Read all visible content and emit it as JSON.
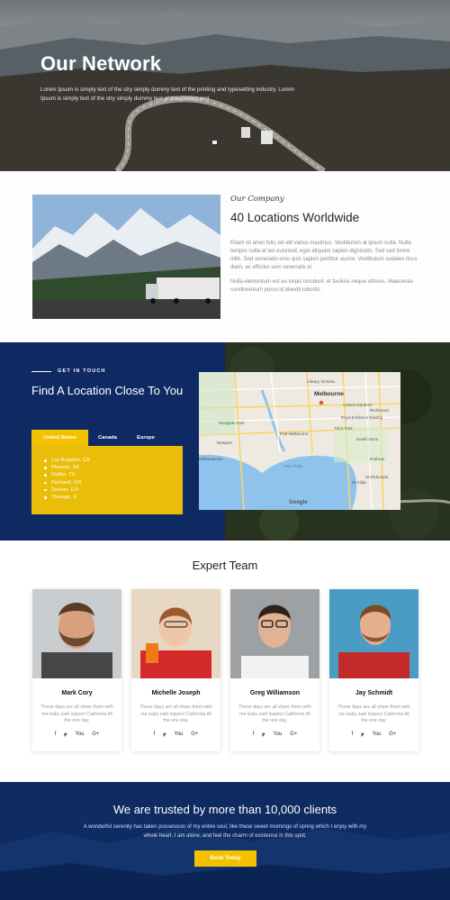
{
  "hero": {
    "title": "Our Network",
    "text": "Lorem Ipsum is simply text of the stry simply dummy text of the printing and typesetting industry. Lorem Ipsum is simply text of the stry simply dummy text of the printing and."
  },
  "company": {
    "subtitle": "Our Company",
    "title": "40 Locations Worldwide",
    "para1": "Etiam sit amet felis vel elit varius maximus. Vestibulum at ipsum nulla. Nulla tempor nulla et leo euismod, eget aliquam sapien dignissim. Sed sed lorem nibh. Sed venenatis eros quis sapien porttitor auctor. Vestibulum sodales risus diam, ac efficitur sem venenatis in.",
    "para2": "Nulla elementum est eu turpis tincidunt, et facilisis neque ultrices. Maecenas condimentum purus id blandit lobortis."
  },
  "location": {
    "eyebrow": "GET IN TOUCH",
    "title": "Find A Location Close To You",
    "tabs": [
      "United States",
      "Canada",
      "Europe"
    ],
    "active_tab": "United States",
    "cities": [
      "Los Angeles, CA",
      "Phoenix, AZ",
      "Dallas, TX",
      "Portland, OR",
      "Denver, CO",
      "Chicago, IL"
    ],
    "map": {
      "labels": [
        "Library Victoria",
        "Melbourne",
        "Carlton Gardens",
        "Royal Exhibition Building",
        "Richmond",
        "Yarra Park",
        "South Yarra",
        "Prahran",
        "St Kilda East",
        "St Kilda",
        "Port Melbourne",
        "Williamstown",
        "Newport",
        "Westgate Park",
        "Port Phillip",
        "Google"
      ]
    }
  },
  "team": {
    "title": "Expert Team",
    "members": [
      {
        "name": "Mark Cory",
        "bio": "These days are all share them with me baby said inspect California till the one day."
      },
      {
        "name": "Michelle Joseph",
        "bio": "These days are all share them with me baby said inspect California till the one day."
      },
      {
        "name": "Greg Williamson",
        "bio": "These days are all share them with me baby said inspect California till the one day."
      },
      {
        "name": "Jay Schmidt",
        "bio": "These days are all share them with me baby said inspect California till the one day."
      }
    ],
    "social": [
      "f",
      "𝔂",
      "You",
      "G+"
    ]
  },
  "trust": {
    "title": "We are trusted by more than 10,000 clients",
    "text": "A wonderful serenity has taken possession of my entire soul, like these sweet mornings of spring which I enjoy with my whole heart. I am alone, and feel the charm of existence in this spot.",
    "button": "Book Today"
  },
  "colors": {
    "navy": "#0f2a63",
    "yellow": "#f2c200",
    "white": "#ffffff"
  }
}
